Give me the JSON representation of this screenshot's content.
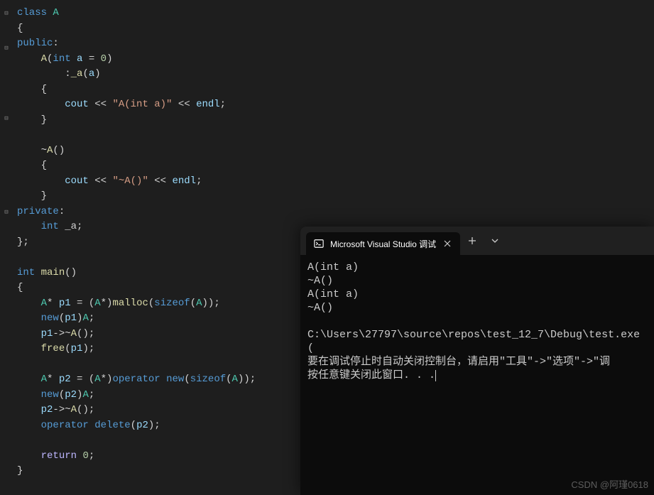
{
  "code": {
    "lines": [
      {
        "fold": "minus",
        "tokens": [
          {
            "t": "class ",
            "c": "kw"
          },
          {
            "t": "A",
            "c": "type"
          }
        ]
      },
      {
        "tokens": [
          {
            "t": "{",
            "c": "punc"
          }
        ]
      },
      {
        "tokens": [
          {
            "t": "public",
            "c": "kw"
          },
          {
            "t": ":",
            "c": "punc"
          }
        ]
      },
      {
        "fold": "minus",
        "tokens": [
          {
            "t": "    ",
            "c": ""
          },
          {
            "t": "A",
            "c": "fn"
          },
          {
            "t": "(",
            "c": "punc"
          },
          {
            "t": "int",
            "c": "kw"
          },
          {
            "t": " ",
            "c": ""
          },
          {
            "t": "a",
            "c": "param"
          },
          {
            "t": " = ",
            "c": "op"
          },
          {
            "t": "0",
            "c": "num"
          },
          {
            "t": ")",
            "c": "punc"
          }
        ]
      },
      {
        "tokens": [
          {
            "t": "        :",
            "c": "punc"
          },
          {
            "t": "_a",
            "c": "fn"
          },
          {
            "t": "(",
            "c": "punc"
          },
          {
            "t": "a",
            "c": "param"
          },
          {
            "t": ")",
            "c": "punc"
          }
        ]
      },
      {
        "tokens": [
          {
            "t": "    {",
            "c": "punc"
          }
        ]
      },
      {
        "tokens": [
          {
            "t": "        ",
            "c": ""
          },
          {
            "t": "cout",
            "c": "param"
          },
          {
            "t": " << ",
            "c": "op"
          },
          {
            "t": "\"A(int a)\"",
            "c": "str"
          },
          {
            "t": " << ",
            "c": "op"
          },
          {
            "t": "endl",
            "c": "param"
          },
          {
            "t": ";",
            "c": "punc"
          }
        ]
      },
      {
        "tokens": [
          {
            "t": "    }",
            "c": "punc"
          }
        ]
      },
      {
        "tokens": [
          {
            "t": "",
            "c": ""
          }
        ]
      },
      {
        "fold": "minus",
        "tokens": [
          {
            "t": "    ~",
            "c": "punc"
          },
          {
            "t": "A",
            "c": "fn"
          },
          {
            "t": "()",
            "c": "punc"
          }
        ]
      },
      {
        "tokens": [
          {
            "t": "    {",
            "c": "punc"
          }
        ]
      },
      {
        "tokens": [
          {
            "t": "        ",
            "c": ""
          },
          {
            "t": "cout",
            "c": "param"
          },
          {
            "t": " << ",
            "c": "op"
          },
          {
            "t": "\"~A()\"",
            "c": "str"
          },
          {
            "t": " << ",
            "c": "op"
          },
          {
            "t": "endl",
            "c": "param"
          },
          {
            "t": ";",
            "c": "punc"
          }
        ]
      },
      {
        "tokens": [
          {
            "t": "    }",
            "c": "punc"
          }
        ]
      },
      {
        "tokens": [
          {
            "t": "private",
            "c": "kw"
          },
          {
            "t": ":",
            "c": "punc"
          }
        ]
      },
      {
        "tokens": [
          {
            "t": "    ",
            "c": ""
          },
          {
            "t": "int",
            "c": "kw"
          },
          {
            "t": " _a;",
            "c": "punc"
          }
        ]
      },
      {
        "tokens": [
          {
            "t": "};",
            "c": "punc"
          }
        ]
      },
      {
        "tokens": [
          {
            "t": "",
            "c": ""
          }
        ]
      },
      {
        "fold": "minus",
        "tokens": [
          {
            "t": "int",
            "c": "kw"
          },
          {
            "t": " ",
            "c": ""
          },
          {
            "t": "main",
            "c": "fn"
          },
          {
            "t": "()",
            "c": "punc"
          }
        ]
      },
      {
        "tokens": [
          {
            "t": "{",
            "c": "punc"
          }
        ]
      },
      {
        "tokens": [
          {
            "t": "    ",
            "c": ""
          },
          {
            "t": "A",
            "c": "type"
          },
          {
            "t": "* ",
            "c": "punc"
          },
          {
            "t": "p1",
            "c": "param"
          },
          {
            "t": " = (",
            "c": "punc"
          },
          {
            "t": "A",
            "c": "type"
          },
          {
            "t": "*)",
            "c": "punc"
          },
          {
            "t": "malloc",
            "c": "fn"
          },
          {
            "t": "(",
            "c": "punc"
          },
          {
            "t": "sizeof",
            "c": "kw"
          },
          {
            "t": "(",
            "c": "punc"
          },
          {
            "t": "A",
            "c": "type"
          },
          {
            "t": "));",
            "c": "punc"
          }
        ]
      },
      {
        "tokens": [
          {
            "t": "    ",
            "c": ""
          },
          {
            "t": "new",
            "c": "kw"
          },
          {
            "t": "(",
            "c": "punc"
          },
          {
            "t": "p1",
            "c": "param"
          },
          {
            "t": ")",
            "c": "punc"
          },
          {
            "t": "A",
            "c": "type"
          },
          {
            "t": ";",
            "c": "punc"
          }
        ]
      },
      {
        "tokens": [
          {
            "t": "    ",
            "c": ""
          },
          {
            "t": "p1",
            "c": "param"
          },
          {
            "t": "->~",
            "c": "punc"
          },
          {
            "t": "A",
            "c": "fn"
          },
          {
            "t": "();",
            "c": "punc"
          }
        ]
      },
      {
        "tokens": [
          {
            "t": "    ",
            "c": ""
          },
          {
            "t": "free",
            "c": "fn"
          },
          {
            "t": "(",
            "c": "punc"
          },
          {
            "t": "p1",
            "c": "param"
          },
          {
            "t": ");",
            "c": "punc"
          }
        ]
      },
      {
        "tokens": [
          {
            "t": "",
            "c": ""
          }
        ]
      },
      {
        "tokens": [
          {
            "t": "    ",
            "c": ""
          },
          {
            "t": "A",
            "c": "type"
          },
          {
            "t": "* ",
            "c": "punc"
          },
          {
            "t": "p2",
            "c": "param"
          },
          {
            "t": " = (",
            "c": "punc"
          },
          {
            "t": "A",
            "c": "type"
          },
          {
            "t": "*)",
            "c": "punc"
          },
          {
            "t": "operator",
            "c": "kw"
          },
          {
            "t": " ",
            "c": ""
          },
          {
            "t": "new",
            "c": "kw"
          },
          {
            "t": "(",
            "c": "punc"
          },
          {
            "t": "sizeof",
            "c": "kw"
          },
          {
            "t": "(",
            "c": "punc"
          },
          {
            "t": "A",
            "c": "type"
          },
          {
            "t": "));",
            "c": "punc"
          }
        ]
      },
      {
        "tokens": [
          {
            "t": "    ",
            "c": ""
          },
          {
            "t": "new",
            "c": "kw"
          },
          {
            "t": "(",
            "c": "punc"
          },
          {
            "t": "p2",
            "c": "param"
          },
          {
            "t": ")",
            "c": "punc"
          },
          {
            "t": "A",
            "c": "type"
          },
          {
            "t": ";",
            "c": "punc"
          }
        ]
      },
      {
        "tokens": [
          {
            "t": "    ",
            "c": ""
          },
          {
            "t": "p2",
            "c": "param"
          },
          {
            "t": "->~",
            "c": "punc"
          },
          {
            "t": "A",
            "c": "fn"
          },
          {
            "t": "();",
            "c": "punc"
          }
        ]
      },
      {
        "tokens": [
          {
            "t": "    ",
            "c": ""
          },
          {
            "t": "operator",
            "c": "kw"
          },
          {
            "t": " ",
            "c": ""
          },
          {
            "t": "delete",
            "c": "kw"
          },
          {
            "t": "(",
            "c": "punc"
          },
          {
            "t": "p2",
            "c": "param"
          },
          {
            "t": ");",
            "c": "punc"
          }
        ]
      },
      {
        "tokens": [
          {
            "t": "",
            "c": ""
          }
        ]
      },
      {
        "tokens": [
          {
            "t": "    ",
            "c": ""
          },
          {
            "t": "return",
            "c": "macro"
          },
          {
            "t": " ",
            "c": ""
          },
          {
            "t": "0",
            "c": "num"
          },
          {
            "t": ";",
            "c": "punc"
          }
        ]
      },
      {
        "tokens": [
          {
            "t": "}",
            "c": "punc"
          }
        ]
      }
    ]
  },
  "terminal": {
    "tab_title": "Microsoft Visual Studio 调试",
    "output": "A(int a)\n~A()\nA(int a)\n~A()\n\nC:\\Users\\27797\\source\\repos\\test_12_7\\Debug\\test.exe (\n要在调试停止时自动关闭控制台，请启用\"工具\"->\"选项\"->\"调\n按任意键关闭此窗口. . ."
  },
  "watermark": "CSDN @阿瑾0618"
}
